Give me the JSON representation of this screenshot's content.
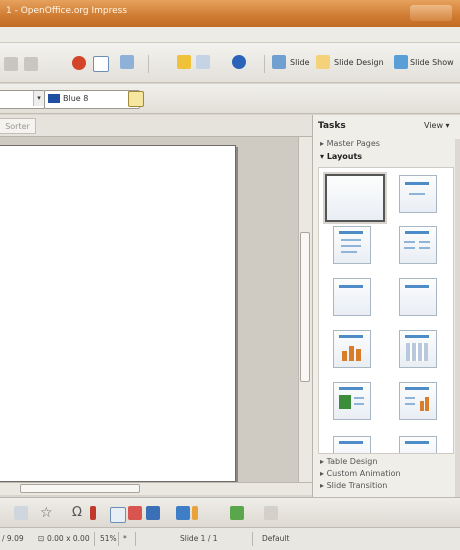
{
  "window": {
    "title": "1 - OpenOffice.org Impress"
  },
  "toolbar1": {
    "slide_label": "Slide",
    "slide_design_label": "Slide Design",
    "slide_show_label": "Slide Show"
  },
  "toolbar2": {
    "line_color_value": "Blue 8"
  },
  "workarea": {
    "tab_slide_sorter": "Sorter"
  },
  "tasks": {
    "title": "Tasks",
    "view_label": "View",
    "sections": {
      "master_pages": "Master Pages",
      "layouts": "Layouts",
      "table_design": "Table Design",
      "custom_animation": "Custom Animation",
      "slide_transition": "Slide Transition"
    }
  },
  "statusbar": {
    "position": "/ 9.09",
    "size": "0.00 x 0.00",
    "zoom": "51%",
    "modified": "*",
    "slide": "Slide 1 / 1",
    "layout": "Default"
  },
  "colors": {
    "titlebar": "#cf7b32",
    "accent_blue": "#4d8cc6"
  }
}
